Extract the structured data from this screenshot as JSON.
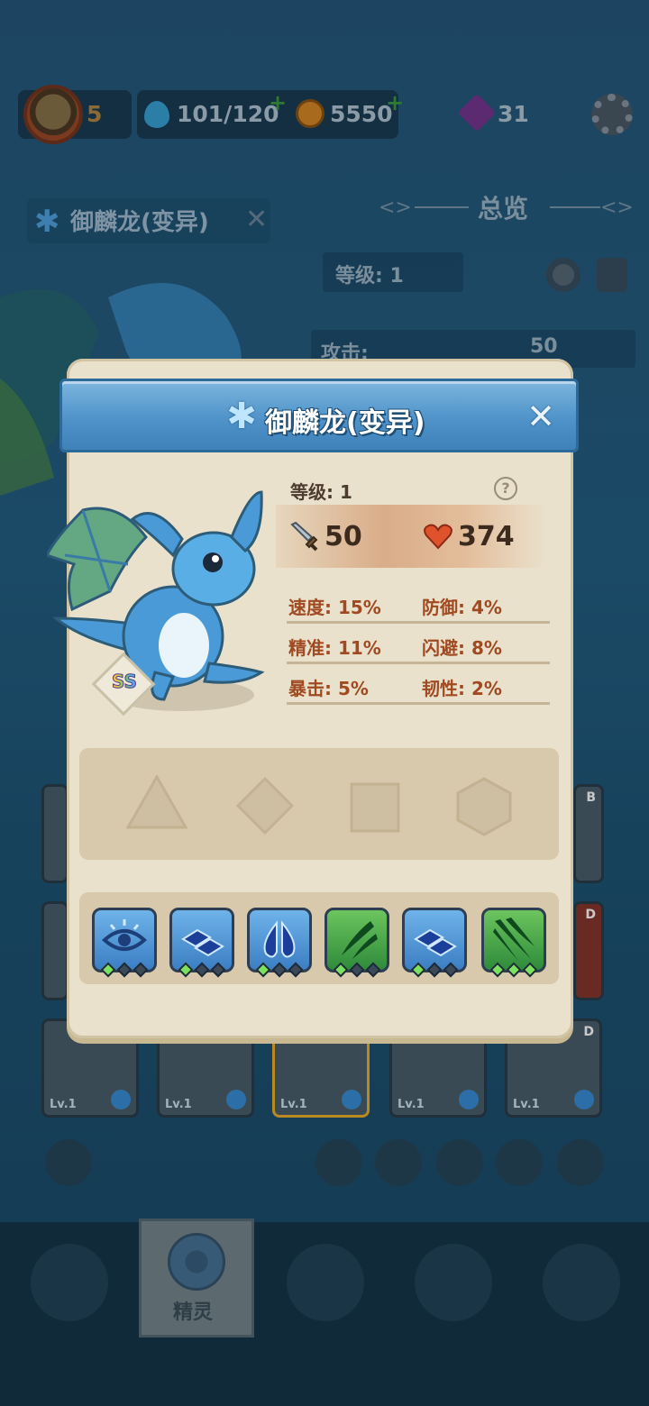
{
  "topbar": {
    "player_level": "5",
    "stamina": "101/120",
    "coins": "5550",
    "gems": "31",
    "icons": [
      "avatar",
      "water-drop-icon",
      "coin-icon",
      "purple-gem-icon",
      "gear-icon"
    ]
  },
  "background_panel": {
    "creature_name": "御麟龙(变异)",
    "overview_title": "总览",
    "level_text": "等级: 1",
    "attack_label": "攻击:",
    "attack_value": "50"
  },
  "bg_cards": {
    "lv_label": "Lv.1",
    "grade_b": "B",
    "grade_d": "D"
  },
  "bottom_nav": {
    "active_label": "精灵"
  },
  "dialog": {
    "title": "御麟龙(变异)",
    "rank": "SS",
    "level_text": "等级: 1",
    "help_glyph": "?",
    "attack": "50",
    "hp": "374",
    "stats": [
      {
        "left": "速度: 15%",
        "right": "防御: 4%"
      },
      {
        "left": "精准: 11%",
        "right": "闪避: 8%"
      },
      {
        "left": "暴击: 5%",
        "right": "韧性: 2%"
      }
    ],
    "slots": [
      "triangle",
      "diamond",
      "square",
      "hexagon"
    ],
    "skills": [
      {
        "icon": "eye-icon",
        "color": "blue",
        "stars": 1
      },
      {
        "icon": "water-tiles-icon",
        "color": "blue",
        "stars": 1
      },
      {
        "icon": "split-drop-icon",
        "color": "blue",
        "stars": 1
      },
      {
        "icon": "slash-icon",
        "color": "green",
        "stars": 1
      },
      {
        "icon": "water-tiles-icon",
        "color": "blue",
        "stars": 1
      },
      {
        "icon": "claw-slash-icon",
        "color": "green",
        "stars": 3
      }
    ]
  },
  "colors": {
    "dialog_bg": "#eae1cc",
    "header_blue": "#4f93c9",
    "stat_text": "#a04a22",
    "water_element": "#2c6fa8"
  }
}
